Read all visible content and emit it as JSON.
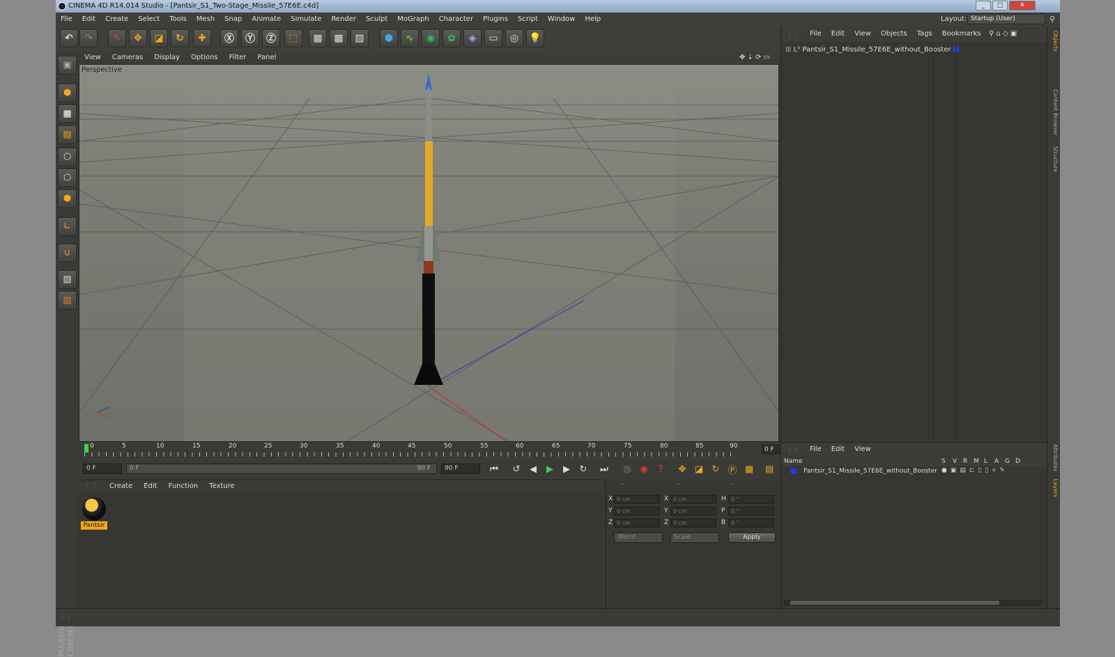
{
  "window": {
    "title": "CINEMA 4D R14.014 Studio - [Pantsir_S1_Two-Stage_Missile_57E6E.c4d]",
    "min": "_",
    "max": "□",
    "close": "✕"
  },
  "menubar": {
    "items": [
      "File",
      "Edit",
      "Create",
      "Select",
      "Tools",
      "Mesh",
      "Snap",
      "Animate",
      "Simulate",
      "Render",
      "Sculpt",
      "MoGraph",
      "Character",
      "Plugins",
      "Script",
      "Window",
      "Help"
    ],
    "layout_label": "Layout:",
    "layout_value": "Startup (User)"
  },
  "viewport": {
    "menu": [
      "View",
      "Cameras",
      "Display",
      "Options",
      "Filter",
      "Panel"
    ],
    "label": "Perspective"
  },
  "timeline": {
    "ticks": [
      "0",
      "5",
      "10",
      "15",
      "20",
      "25",
      "30",
      "35",
      "40",
      "45",
      "50",
      "55",
      "60",
      "65",
      "70",
      "75",
      "80",
      "85",
      "90"
    ],
    "current_frame": "0 F"
  },
  "transport": {
    "start": "0 F",
    "range_start": "0 F",
    "range_end": "90 F",
    "end": "90 F"
  },
  "material_panel": {
    "menu": [
      "Create",
      "Edit",
      "Function",
      "Texture"
    ],
    "material_name": "Pantsir"
  },
  "coordinates": {
    "header": [
      "--",
      "--",
      "--"
    ],
    "rows": [
      {
        "a": "X",
        "av": "0 cm",
        "b": "X",
        "bv": "0 cm",
        "c": "H",
        "cv": "0 °"
      },
      {
        "a": "Y",
        "av": "0 cm",
        "b": "Y",
        "bv": "0 cm",
        "c": "P",
        "cv": "0 °"
      },
      {
        "a": "Z",
        "av": "0 cm",
        "b": "Z",
        "bv": "0 cm",
        "c": "B",
        "cv": "0 °"
      }
    ],
    "mode1": "World",
    "mode2": "Scale",
    "apply": "Apply"
  },
  "object_manager": {
    "menu": [
      "File",
      "Edit",
      "View",
      "Objects",
      "Tags",
      "Bookmarks"
    ],
    "object_name": "Pantsir_S1_Missile_57E6E_without_Booster",
    "color": "#1b3fe8"
  },
  "attribute_manager": {
    "menu": [
      "File",
      "Edit",
      "View"
    ],
    "columns": [
      "Name",
      "S",
      "V",
      "R",
      "M",
      "L",
      "A",
      "G",
      "D"
    ],
    "row_name": "Pantsir_S1_Missile_57E6E_without_Booster"
  },
  "right_tabs": [
    "Objects",
    "Content Browser",
    "Structure",
    "Attributes",
    "Layers"
  ],
  "brand": "MAXON CINEMA 4D"
}
